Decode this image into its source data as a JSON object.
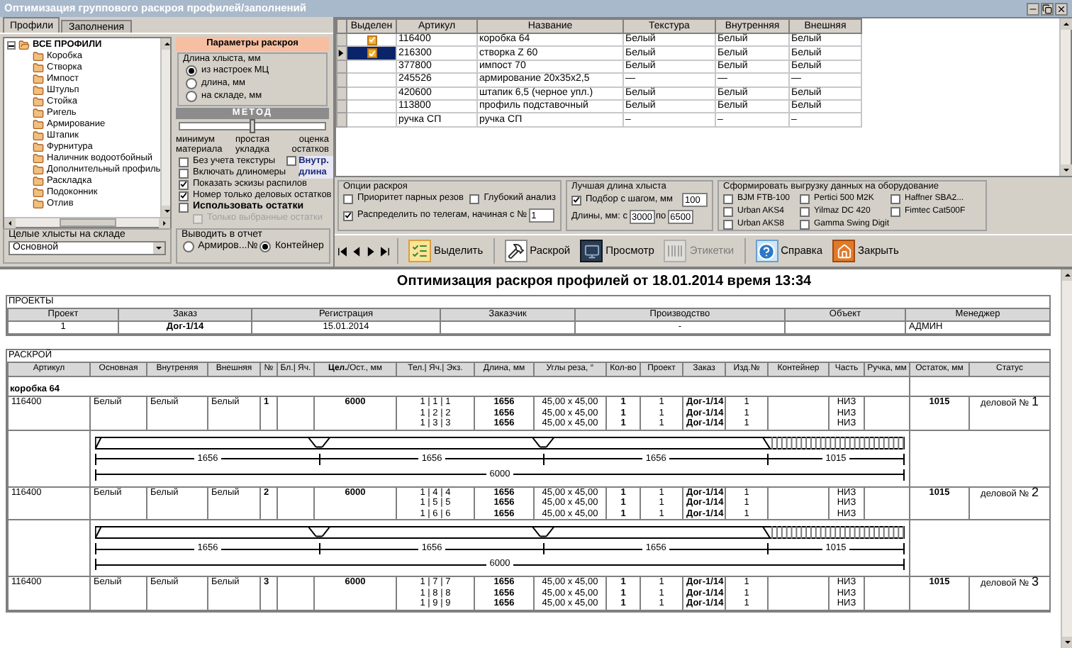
{
  "window": {
    "title": "Оптимизация группового раскроя профилей/заполнений"
  },
  "left_tabs": [
    {
      "label": "Профили",
      "selected": true
    },
    {
      "label": "Заполнения",
      "selected": false
    }
  ],
  "tree": [
    {
      "label": "ВСЕ ПРОФИЛИ",
      "expanded": true,
      "children": [
        {
          "label": "Коробка"
        },
        {
          "label": "Створка"
        },
        {
          "label": "Импост"
        },
        {
          "label": "Штульп"
        },
        {
          "label": "Стойка"
        },
        {
          "label": "Ригель"
        },
        {
          "label": "Армирование"
        },
        {
          "label": "Штапик"
        },
        {
          "label": "Фурнитура"
        },
        {
          "label": "Наличник водоотбойный"
        },
        {
          "label": "Дополнительный профиль"
        },
        {
          "label": "Раскладка"
        },
        {
          "label": "Подоконник"
        },
        {
          "label": "Отлив"
        }
      ]
    }
  ],
  "params": {
    "title": "Параметры раскроя",
    "length_group": {
      "title": "Длина хлыста, мм",
      "options": [
        {
          "label": "из настроек МЦ",
          "selected": true
        },
        {
          "label": "длина, мм",
          "selected": false
        },
        {
          "label": "на складе, мм",
          "selected": false
        }
      ]
    },
    "method": {
      "title": "МЕТОД",
      "level": 0.5,
      "labels": [
        "минимум материала",
        "простая укладка",
        "оценка остатков"
      ]
    },
    "inner_length": {
      "label": "Внутр. длина",
      "checked": false
    },
    "checkboxes": [
      {
        "label": "Без учета текстуры",
        "checked": false,
        "disabled": false,
        "kind": "normal"
      },
      {
        "label": "Включать длиномеры",
        "checked": false,
        "disabled": false,
        "kind": "normal"
      },
      {
        "label": "Показать эскизы распилов",
        "checked": true,
        "disabled": false,
        "kind": "normal"
      },
      {
        "label": "Номер только деловых остатков",
        "checked": true,
        "disabled": false,
        "kind": "normal"
      },
      {
        "label": "Использовать остатки",
        "checked": false,
        "disabled": false,
        "kind": "strong"
      },
      {
        "label": "Только выбранные остатки",
        "checked": false,
        "disabled": true,
        "kind": "sub"
      }
    ]
  },
  "stock": {
    "title": "Целые хлысты на складе",
    "value": "Основной"
  },
  "report_output": {
    "title": "Выводить в отчет",
    "options": [
      {
        "label": "Армиров...№",
        "selected": false
      },
      {
        "label": "Контейнер",
        "selected": true
      }
    ]
  },
  "grid": {
    "check_column": "Выделен",
    "columns": [
      "Артикул",
      "Название",
      "Текстура",
      "Внутренняя",
      "Внешняя"
    ],
    "rows": [
      {
        "selected": false,
        "checked": true,
        "cells": [
          "116400",
          "коробка 64",
          "Белый",
          "Белый",
          "Белый"
        ]
      },
      {
        "selected": true,
        "checked": true,
        "cells": [
          "216300",
          "створка Z 60",
          "Белый",
          "Белый",
          "Белый"
        ]
      },
      {
        "selected": false,
        "checked": false,
        "cells": [
          "377800",
          "импост 70",
          "Белый",
          "Белый",
          "Белый"
        ]
      },
      {
        "selected": false,
        "checked": false,
        "cells": [
          "245526",
          "армирование 20x35x2,5",
          "—",
          "—",
          "—"
        ]
      },
      {
        "selected": false,
        "checked": false,
        "cells": [
          "420600",
          "штапик 6,5 (черное упл.)",
          "Белый",
          "Белый",
          "Белый"
        ]
      },
      {
        "selected": false,
        "checked": false,
        "cells": [
          "113800",
          "профиль подставочный",
          "Белый",
          "Белый",
          "Белый"
        ]
      },
      {
        "selected": false,
        "checked": false,
        "cells": [
          "ручка СП",
          "ручка СП",
          "–",
          "–",
          "–"
        ]
      }
    ]
  },
  "cut_options": {
    "title": "Опции раскроя",
    "pair_priority": {
      "label": "Приоритет парных резов",
      "checked": false
    },
    "deep_analysis": {
      "label": "Глубокий анализ",
      "checked": false
    },
    "distribute": {
      "label": "Распределить по телегам, начиная с №",
      "checked": true,
      "value": "1"
    }
  },
  "best_length": {
    "title": "Лучшая длина хлыста",
    "step": {
      "label": "Подбор с шагом, мм",
      "checked": true,
      "value": "100"
    },
    "range_label": "Длины, мм: с",
    "from": "3000",
    "to_label": "по",
    "to": "6500"
  },
  "export": {
    "title": "Сформировать выгрузку данных на оборудование",
    "machines": [
      {
        "label": "BJM FTB-100",
        "checked": false
      },
      {
        "label": "Pertici 500 M2K",
        "checked": false
      },
      {
        "label": "Haffner SBA2...",
        "checked": false
      },
      {
        "label": "Urban AKS4",
        "checked": false
      },
      {
        "label": "Yilmaz DC 420",
        "checked": false
      },
      {
        "label": "Fimtec Cat500F",
        "checked": false
      },
      {
        "label": "Urban AKS8",
        "checked": false
      },
      {
        "label": "Gamma Swing Digit",
        "checked": false
      }
    ]
  },
  "toolbar": {
    "buttons": [
      {
        "label": "Выделить",
        "kind": "select",
        "disabled": false
      },
      {
        "label": "Раскрой",
        "kind": "cut",
        "disabled": false
      },
      {
        "label": "Просмотр",
        "kind": "preview",
        "disabled": false
      },
      {
        "label": "Этикетки",
        "kind": "labels",
        "disabled": true
      },
      {
        "label": "Справка",
        "kind": "help",
        "disabled": false
      },
      {
        "label": "Закрыть",
        "kind": "close",
        "disabled": false
      }
    ]
  },
  "report": {
    "title": "Оптимизация раскроя профилей от 18.01.2014 время 13:34",
    "projects": {
      "label": "ПРОЕКТЫ",
      "columns": [
        "Проект",
        "Заказ",
        "Регистрация",
        "Заказчик",
        "Производство",
        "Объект",
        "Менеджер"
      ],
      "rows": [
        [
          "1",
          "Дог-1/14",
          "15.01.2014",
          null,
          "-",
          null,
          "АДМИН"
        ]
      ]
    },
    "cutting": {
      "label": "РАСКРОЙ",
      "columns": [
        "Артикул",
        "Основная",
        "Внутреняя",
        "Внешняя",
        "№",
        "Бл.| Яч.",
        "**Цел.**/Ост., мм",
        "Тел.| Яч.| Экз.",
        "Длина, мм",
        "Углы реза, °",
        "Кол-во",
        "Проект",
        "Заказ",
        "Изд.№",
        "Контейнер",
        "Часть",
        "Ручка, мм",
        "Остаток, мм",
        "Статус"
      ],
      "groups": [
        {
          "name": "коробка 64",
          "bars": [
            {
              "article": "116400",
              "main": "Белый",
              "inner": "Белый",
              "outer": "Белый",
              "number": "1",
              "whole": "6000",
              "remainder": "1015",
              "status": "деловой №",
              "status_number": "1",
              "pieces": [
                {
                  "position": "1 | 1 | 1",
                  "length": "1656",
                  "angles": "45,00 x 45,00",
                  "qty": "1",
                  "project": "1",
                  "order": "Дог-1/14",
                  "item": "1",
                  "part": "НИЗ"
                },
                {
                  "position": "1 | 2 | 2",
                  "length": "1656",
                  "angles": "45,00 x 45,00",
                  "qty": "1",
                  "project": "1",
                  "order": "Дог-1/14",
                  "item": "1",
                  "part": "НИЗ"
                },
                {
                  "position": "1 | 3 | 3",
                  "length": "1656",
                  "angles": "45,00 x 45,00",
                  "qty": "1",
                  "project": "1",
                  "order": "Дог-1/14",
                  "item": "1",
                  "part": "НИЗ"
                }
              ],
              "diagram": {
                "segments": [
                  "1656",
                  "1656",
                  "1656"
                ],
                "remainder": "1015",
                "total": "6000"
              }
            },
            {
              "article": "116400",
              "main": "Белый",
              "inner": "Белый",
              "outer": "Белый",
              "number": "2",
              "whole": "6000",
              "remainder": "1015",
              "status": "деловой №",
              "status_number": "2",
              "pieces": [
                {
                  "position": "1 | 4 | 4",
                  "length": "1656",
                  "angles": "45,00 x 45,00",
                  "qty": "1",
                  "project": "1",
                  "order": "Дог-1/14",
                  "item": "1",
                  "part": "НИЗ"
                },
                {
                  "position": "1 | 5 | 5",
                  "length": "1656",
                  "angles": "45,00 x 45,00",
                  "qty": "1",
                  "project": "1",
                  "order": "Дог-1/14",
                  "item": "1",
                  "part": "НИЗ"
                },
                {
                  "position": "1 | 6 | 6",
                  "length": "1656",
                  "angles": "45,00 x 45,00",
                  "qty": "1",
                  "project": "1",
                  "order": "Дог-1/14",
                  "item": "1",
                  "part": "НИЗ"
                }
              ],
              "diagram": {
                "segments": [
                  "1656",
                  "1656",
                  "1656"
                ],
                "remainder": "1015",
                "total": "6000"
              }
            },
            {
              "article": "116400",
              "main": "Белый",
              "inner": "Белый",
              "outer": "Белый",
              "number": "3",
              "whole": "6000",
              "remainder": "1015",
              "status": "деловой №",
              "status_number": "3",
              "pieces": [
                {
                  "position": "1 | 7 | 7",
                  "length": "1656",
                  "angles": "45,00 x 45,00",
                  "qty": "1",
                  "project": "1",
                  "order": "Дог-1/14",
                  "item": "1",
                  "part": "НИЗ"
                },
                {
                  "position": "1 | 8 | 8",
                  "length": "1656",
                  "angles": "45,00 x 45,00",
                  "qty": "1",
                  "project": "1",
                  "order": "Дог-1/14",
                  "item": "1",
                  "part": "НИЗ"
                },
                {
                  "position": "1 | 9 | 9",
                  "length": "1656",
                  "angles": "45,00 x 45,00",
                  "qty": "1",
                  "project": "1",
                  "order": "Дог-1/14",
                  "item": "1",
                  "part": "НИЗ"
                }
              ]
            }
          ]
        }
      ]
    }
  }
}
